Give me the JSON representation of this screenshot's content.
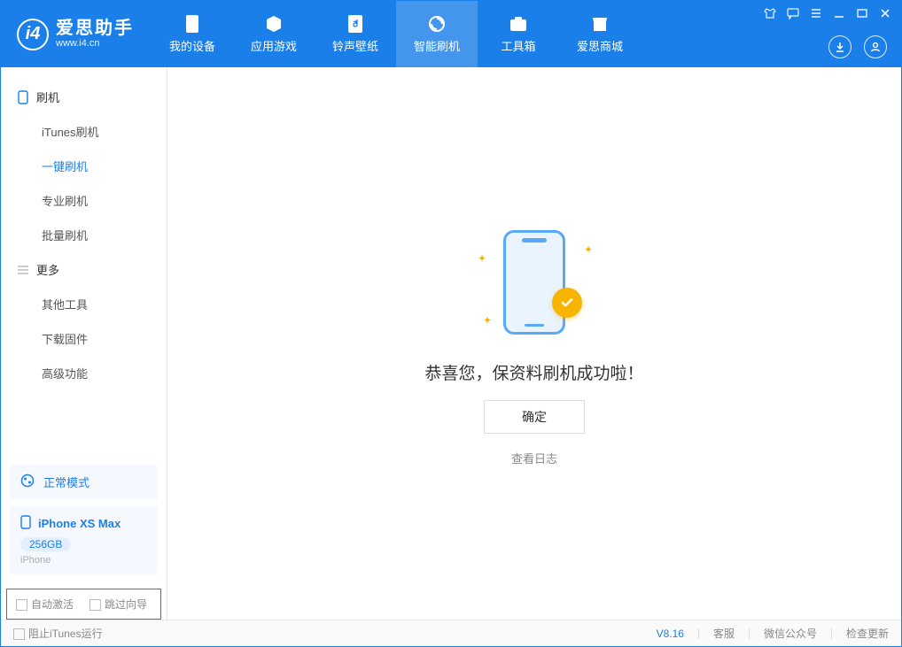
{
  "header": {
    "logo_title": "爱思助手",
    "logo_sub": "www.i4.cn",
    "tabs": [
      {
        "label": "我的设备"
      },
      {
        "label": "应用游戏"
      },
      {
        "label": "铃声壁纸"
      },
      {
        "label": "智能刷机"
      },
      {
        "label": "工具箱"
      },
      {
        "label": "爱思商城"
      }
    ]
  },
  "sidebar": {
    "section1_title": "刷机",
    "items1": [
      {
        "label": "iTunes刷机"
      },
      {
        "label": "一键刷机"
      },
      {
        "label": "专业刷机"
      },
      {
        "label": "批量刷机"
      }
    ],
    "section2_title": "更多",
    "items2": [
      {
        "label": "其他工具"
      },
      {
        "label": "下载固件"
      },
      {
        "label": "高级功能"
      }
    ],
    "mode_label": "正常模式",
    "device_name": "iPhone XS Max",
    "device_storage": "256GB",
    "device_sub": "iPhone",
    "cb_auto_activate": "自动激活",
    "cb_skip_guide": "跳过向导"
  },
  "main": {
    "title": "恭喜您，保资料刷机成功啦！",
    "ok_label": "确定",
    "log_link": "查看日志"
  },
  "footer": {
    "block_itunes": "阻止iTunes运行",
    "version": "V8.16",
    "link_service": "客服",
    "link_wechat": "微信公众号",
    "link_update": "检查更新"
  }
}
